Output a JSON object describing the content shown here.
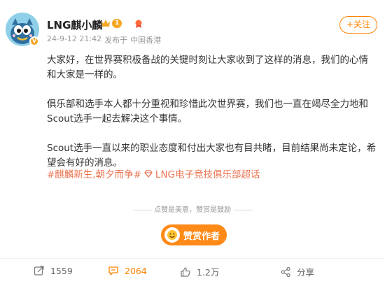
{
  "post": {
    "username": "LNG麒小麟",
    "vip_level": "1",
    "timestamp": "24-9-12 21:42",
    "source_prefix": "发布于",
    "location": "中国香港",
    "follow_label": "+关注",
    "paragraphs": [
      "大家好，在世界赛积极备战的关键时刻让大家收到了这样的消息，我们的心情和大家是一样的。",
      "俱乐部和选手本人都十分重视和珍惜此次世界赛，我们也一直在竭尽全力地和Scout选手一起去解决这个事情。",
      "Scout选手一直以来的职业态度和付出大家也有目共睹，目前结果尚未定论，希望会有好的消息。"
    ],
    "hashtag": "#麒麟新生,朝夕而争#",
    "super_topic": "LNG电子竞技俱乐部超话"
  },
  "reward": {
    "tip_text": "点赞是美意，赞赏是鼓励",
    "button_label": "赞赏作者"
  },
  "actions": {
    "repost_count": "1559",
    "comment_count": "2064",
    "like_count": "1.2万",
    "share_label": "分享"
  },
  "colors": {
    "accent": "#ff8200",
    "tag": "#eb7350",
    "avatar_bg": "#8fd0e8"
  }
}
